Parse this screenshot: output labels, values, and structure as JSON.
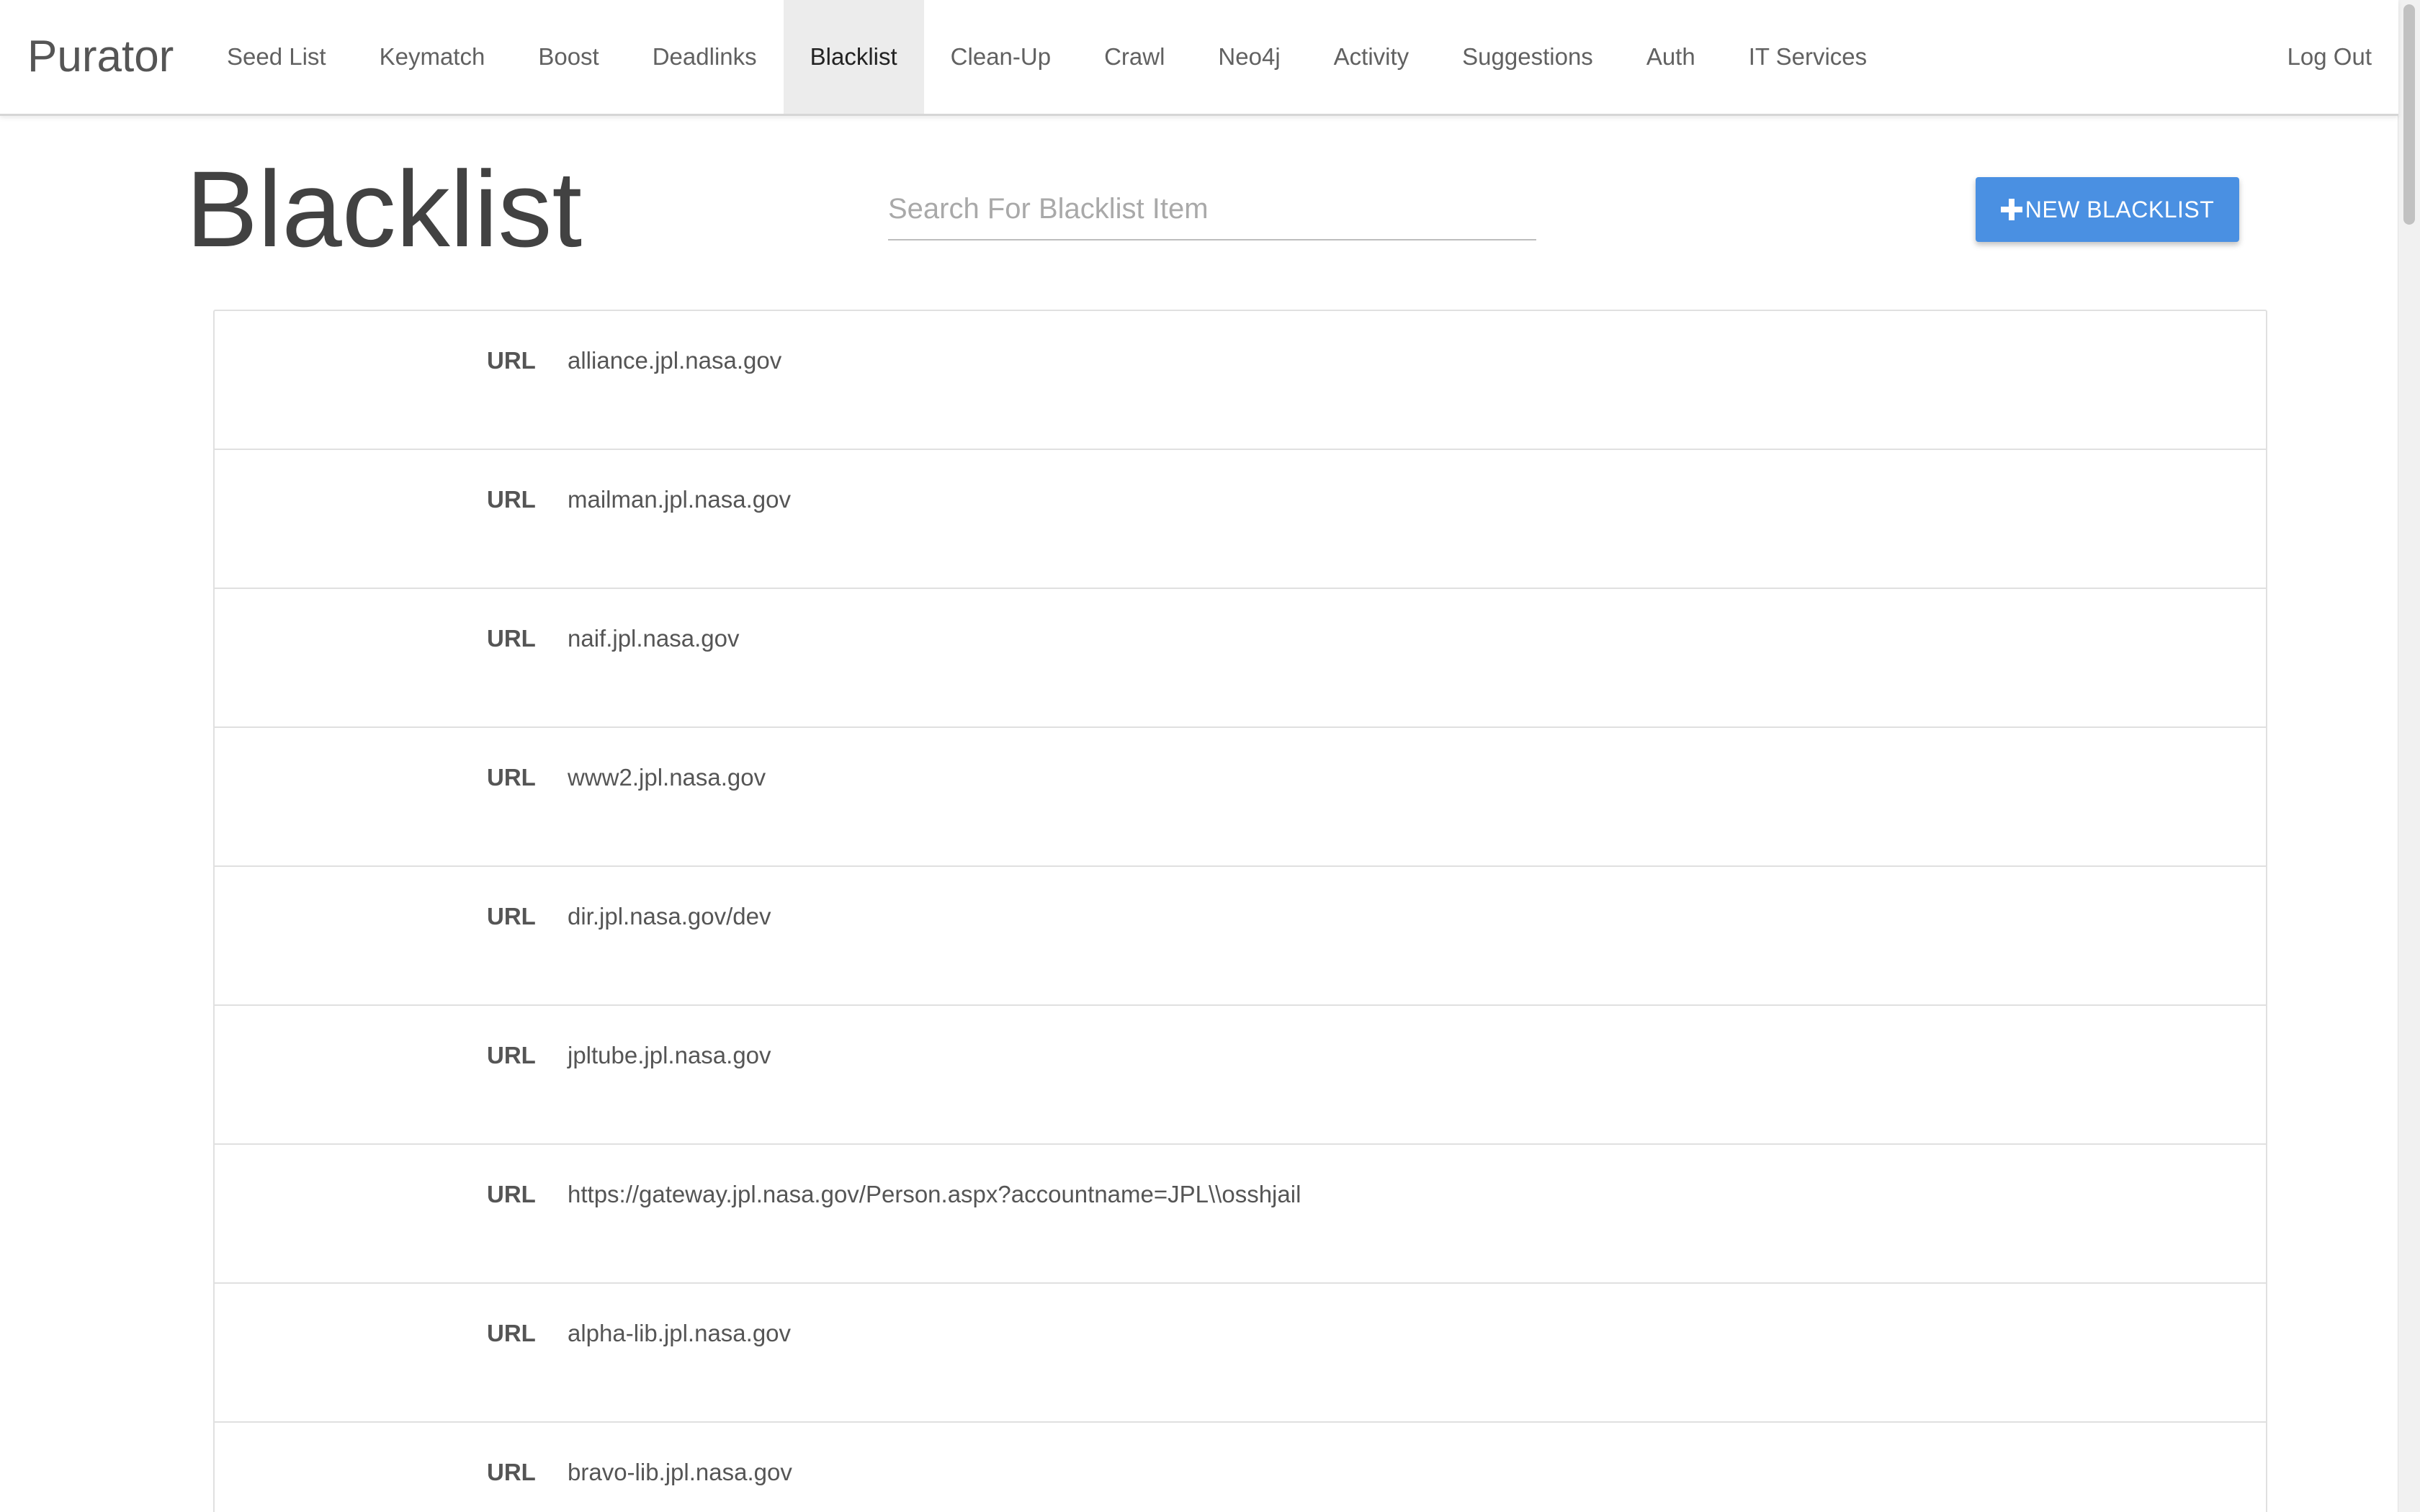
{
  "app": {
    "brand": "Purator"
  },
  "nav": {
    "items": [
      {
        "label": "Seed List",
        "active": false
      },
      {
        "label": "Keymatch",
        "active": false
      },
      {
        "label": "Boost",
        "active": false
      },
      {
        "label": "Deadlinks",
        "active": false
      },
      {
        "label": "Blacklist",
        "active": true
      },
      {
        "label": "Clean-Up",
        "active": false
      },
      {
        "label": "Crawl",
        "active": false
      },
      {
        "label": "Neo4j",
        "active": false
      },
      {
        "label": "Activity",
        "active": false
      },
      {
        "label": "Suggestions",
        "active": false
      },
      {
        "label": "Auth",
        "active": false
      },
      {
        "label": "IT Services",
        "active": false
      }
    ],
    "logout_label": "Log Out"
  },
  "header": {
    "title": "Blacklist",
    "search_placeholder": "Search For Blacklist Item",
    "search_value": "",
    "new_button_label": "NEW BLACKLIST",
    "accent_color": "#4a90e2"
  },
  "blacklist": {
    "rows": [
      {
        "label": "URL",
        "value": "alliance.jpl.nasa.gov"
      },
      {
        "label": "URL",
        "value": "mailman.jpl.nasa.gov"
      },
      {
        "label": "URL",
        "value": "naif.jpl.nasa.gov"
      },
      {
        "label": "URL",
        "value": "www2.jpl.nasa.gov"
      },
      {
        "label": "URL",
        "value": "dir.jpl.nasa.gov/dev"
      },
      {
        "label": "URL",
        "value": "jpltube.jpl.nasa.gov"
      },
      {
        "label": "URL",
        "value": "https://gateway.jpl.nasa.gov/Person.aspx?accountname=JPL\\\\osshjail"
      },
      {
        "label": "URL",
        "value": "alpha-lib.jpl.nasa.gov"
      },
      {
        "label": "URL",
        "value": "bravo-lib.jpl.nasa.gov"
      }
    ]
  }
}
